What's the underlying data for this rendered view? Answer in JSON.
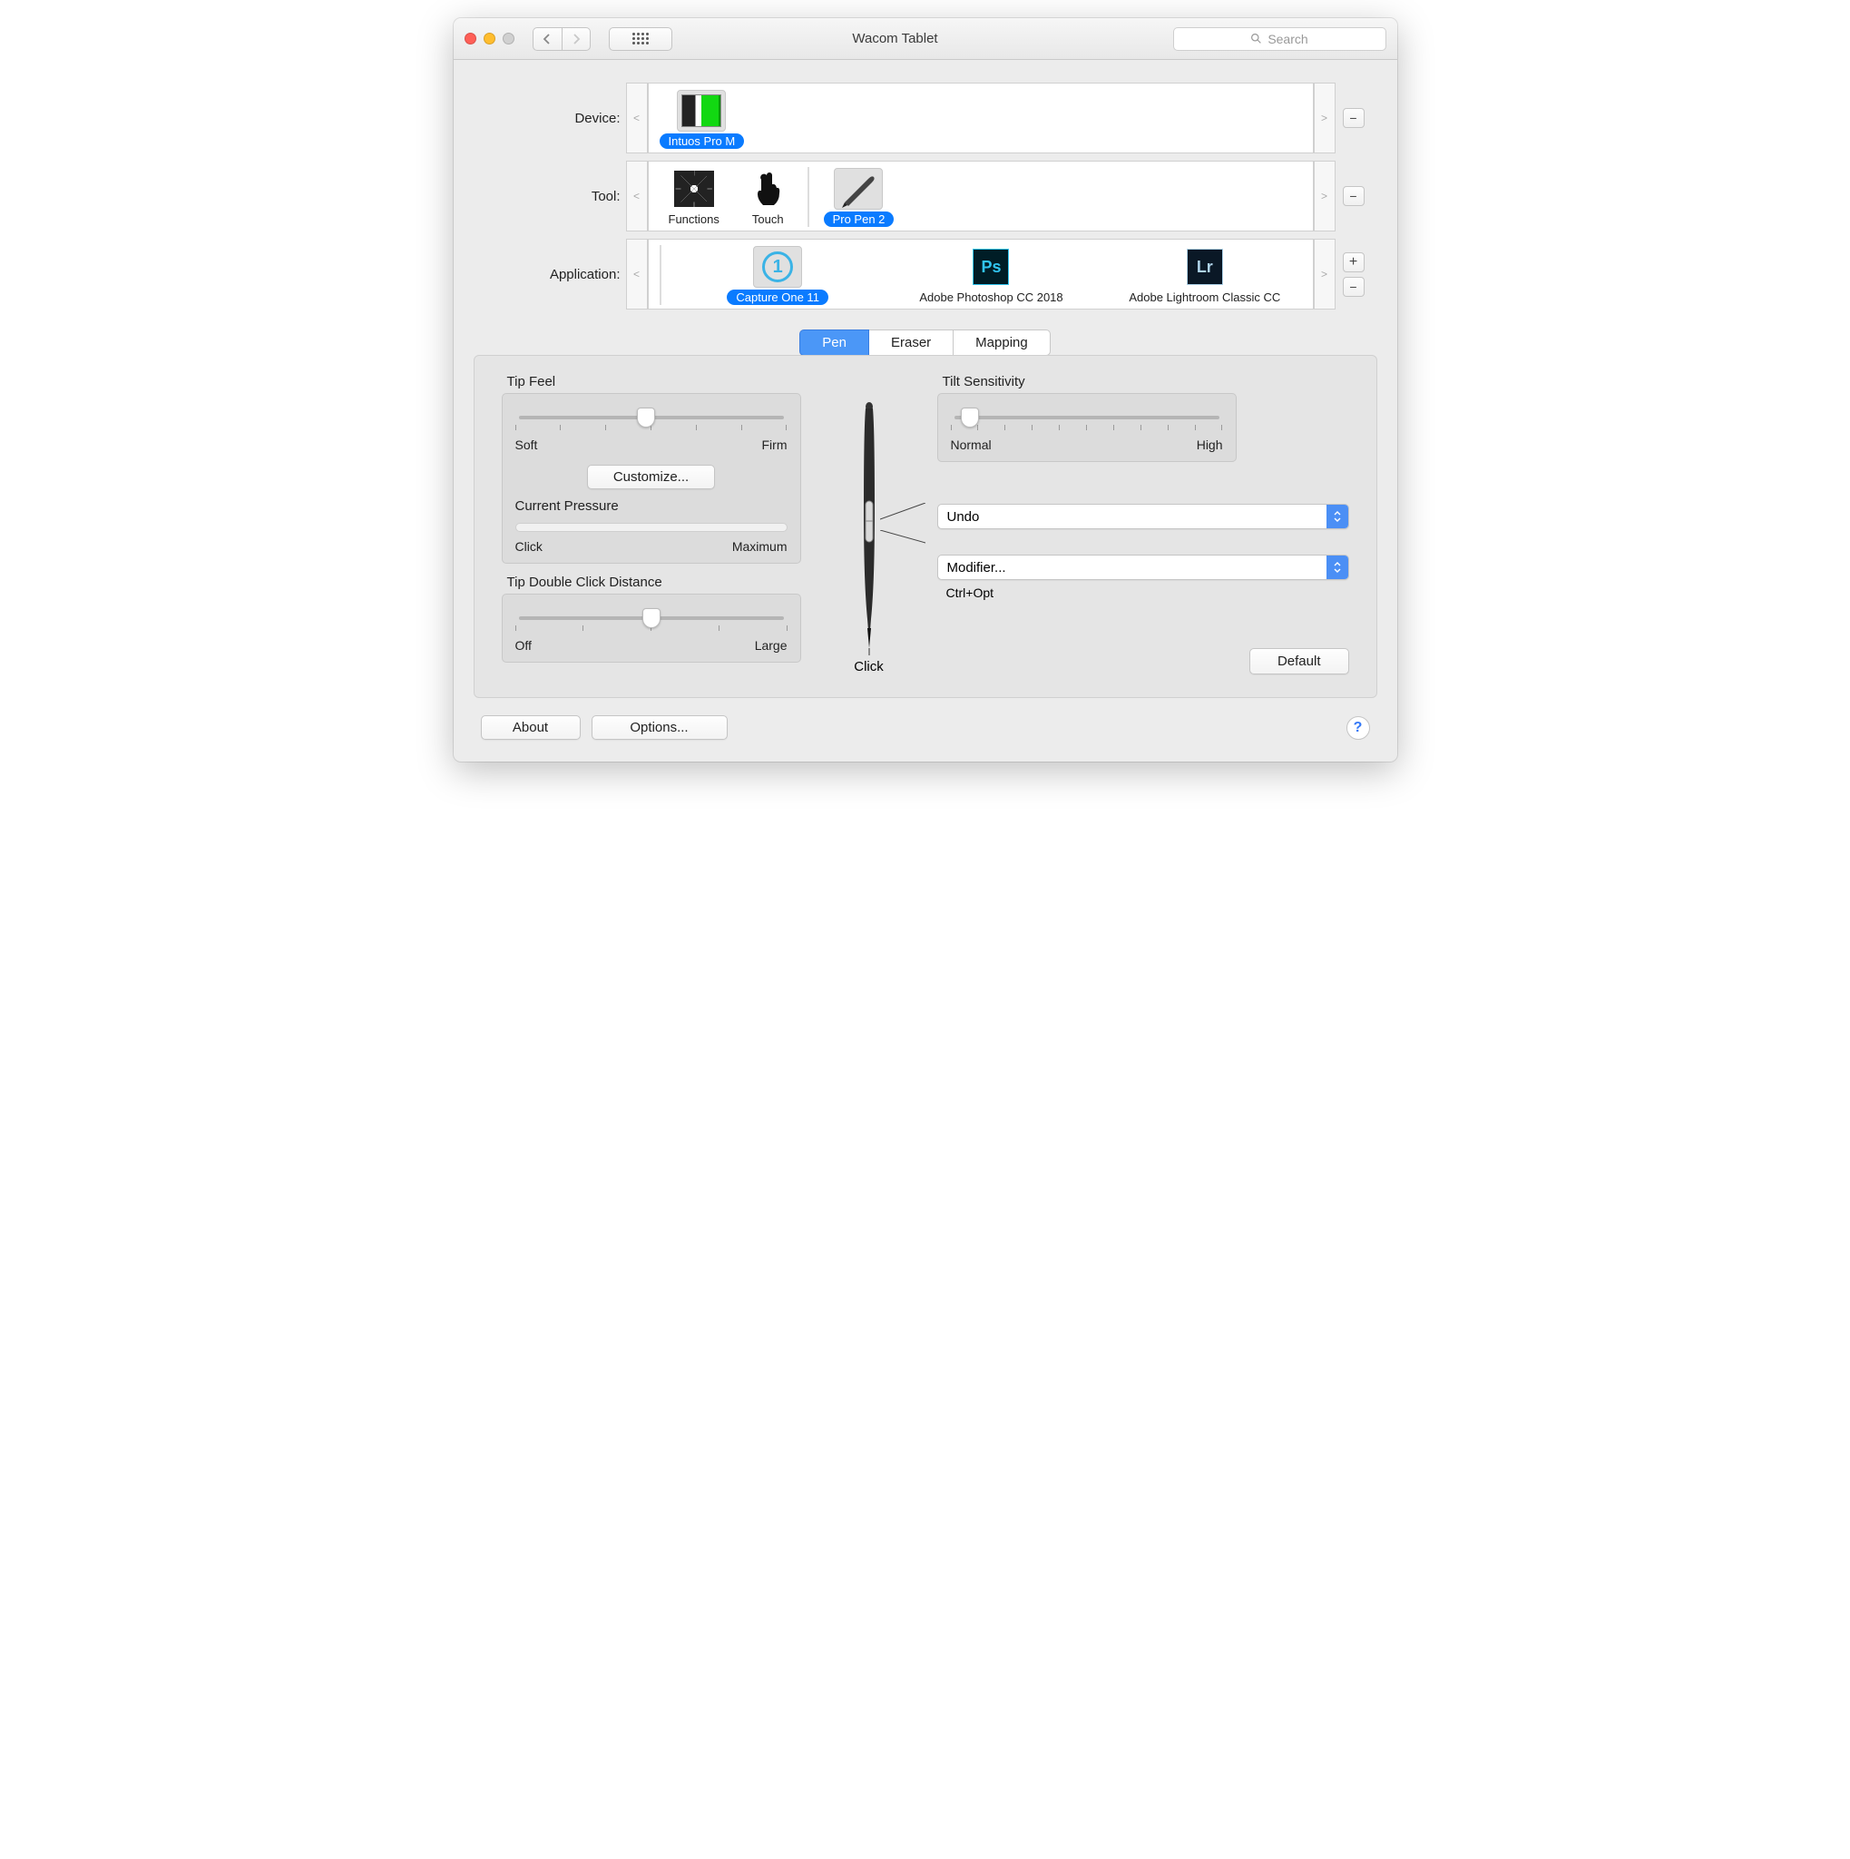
{
  "window": {
    "title": "Wacom Tablet"
  },
  "search": {
    "placeholder": "Search"
  },
  "labels": {
    "device": "Device:",
    "tool": "Tool:",
    "application": "Application:"
  },
  "device": {
    "items": [
      {
        "label": "Intuos Pro M",
        "selected": true
      }
    ]
  },
  "tool": {
    "items": [
      {
        "label": "Functions",
        "selected": false
      },
      {
        "label": "Touch",
        "selected": false
      },
      {
        "label": "Pro Pen 2",
        "selected": true
      }
    ]
  },
  "application": {
    "items": [
      {
        "label": "Capture One 11",
        "selected": true
      },
      {
        "label": "Adobe Photoshop CC 2018",
        "selected": false
      },
      {
        "label": "Adobe Lightroom Classic CC",
        "selected": false
      }
    ]
  },
  "tabs": {
    "pen": "Pen",
    "eraser": "Eraser",
    "mapping": "Mapping"
  },
  "tipfeel": {
    "title": "Tip Feel",
    "min": "Soft",
    "max": "Firm",
    "customize": "Customize..."
  },
  "pressure": {
    "title": "Current Pressure",
    "min": "Click",
    "max": "Maximum"
  },
  "doubleclick": {
    "title": "Tip Double Click Distance",
    "min": "Off",
    "max": "Large"
  },
  "tilt": {
    "title": "Tilt Sensitivity",
    "min": "Normal",
    "max": "High"
  },
  "pen": {
    "upper_button": "Undo",
    "lower_button": "Modifier...",
    "lower_modifier": "Ctrl+Opt",
    "tip": "Click"
  },
  "buttons": {
    "default": "Default",
    "about": "About",
    "options": "Options..."
  }
}
